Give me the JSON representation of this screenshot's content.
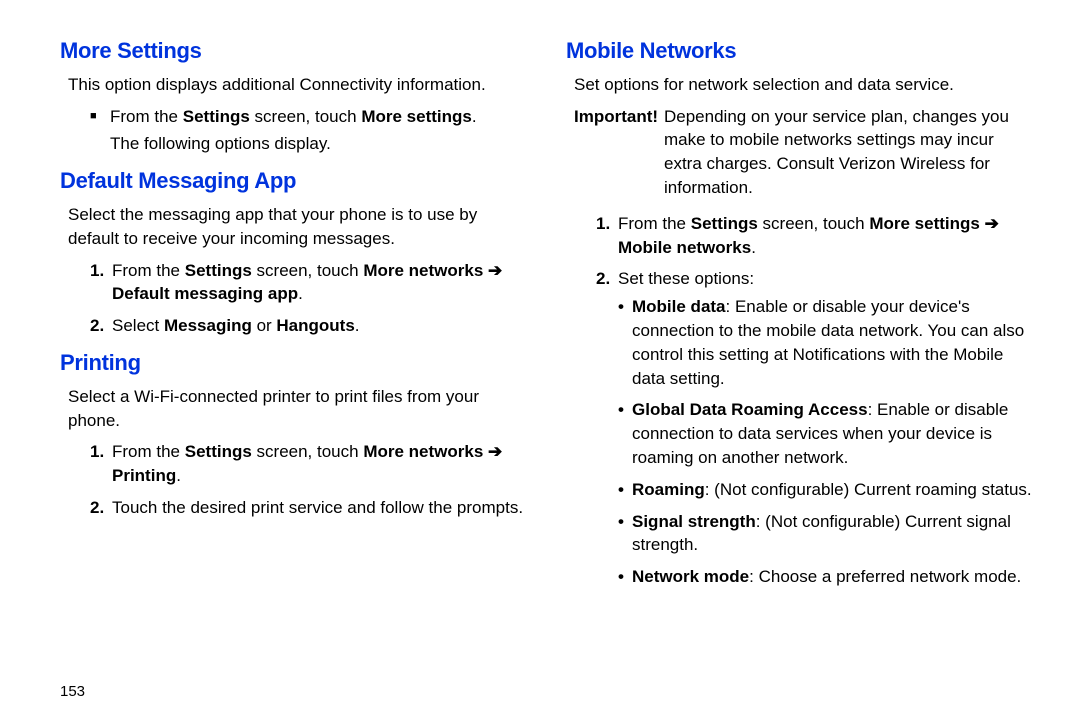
{
  "page_number": "153",
  "left": {
    "h_more": "More Settings",
    "more_intro": "This option displays additional Connectivity information.",
    "more_b1a": "From the ",
    "more_b1b": "Settings",
    "more_b1c": " screen, touch ",
    "more_b1d": "More settings",
    "more_b1e": ".",
    "more_b1_after": "The following options display.",
    "h_default": "Default Messaging App",
    "default_intro": "Select the messaging app that your phone is to use by default to receive your incoming messages.",
    "d1a": "From the ",
    "d1b": "Settings",
    "d1c": " screen, touch ",
    "d1d": "More networks ",
    "d1_arrow": "➔",
    "d1e": "Default messaging app",
    "d1f": ".",
    "d2a": "Select ",
    "d2b": "Messaging",
    "d2c": " or ",
    "d2d": "Hangouts",
    "d2e": ".",
    "h_print": "Printing",
    "print_intro": "Select a Wi-Fi-connected printer to print files from your phone.",
    "p1a": "From the ",
    "p1b": "Settings",
    "p1c": " screen, touch ",
    "p1d": "More networks ",
    "p1_arrow": "➔",
    "p1e": "Printing",
    "p1f": ".",
    "p2": "Touch the desired print service and follow the prompts."
  },
  "right": {
    "h_mobile": "Mobile Networks",
    "mobile_intro": "Set options for network selection and data service.",
    "imp_label": "Important!",
    "imp_text": "Depending on your service plan, changes you make to mobile networks settings may incur extra charges. Consult Verizon Wireless for information.",
    "m1a": "From the ",
    "m1b": "Settings",
    "m1c": " screen, touch ",
    "m1d": "More settings ",
    "m1_arrow": "➔",
    "m1e": "Mobile networks",
    "m1f": ".",
    "m2": "Set these options:",
    "sb1a": "Mobile data",
    "sb1b": ": Enable or disable your device's connection to the mobile data network. You can also control this setting at Notifications with the Mobile data setting.",
    "sb2a": "Global Data Roaming Access",
    "sb2b": ": Enable or disable connection to data services when your device is roaming on another network.",
    "sb3a": "Roaming",
    "sb3b": ": (Not configurable) Current roaming status.",
    "sb4a": "Signal strength",
    "sb4b": ": (Not configurable) Current signal strength.",
    "sb5a": "Network mode",
    "sb5b": ": Choose a preferred network mode."
  }
}
